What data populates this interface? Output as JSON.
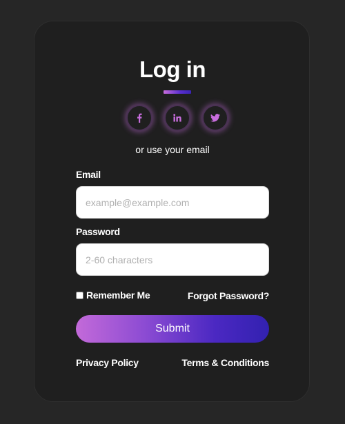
{
  "header": {
    "title": "Log in"
  },
  "social": {
    "buttons": [
      {
        "icon": "facebook-icon",
        "glyph": "f"
      },
      {
        "icon": "linkedin-icon",
        "glyph": "in"
      },
      {
        "icon": "twitter-icon",
        "glyph": "bird"
      }
    ],
    "accent_color": "#c86ddd",
    "alt_text": "or use your email"
  },
  "form": {
    "email": {
      "label": "Email",
      "value": "",
      "placeholder": "example@example.com"
    },
    "password": {
      "label": "Password",
      "value": "",
      "placeholder": "2-60 characters"
    },
    "remember_label": "Remember Me",
    "remember_checked": false,
    "forgot_label": "Forgot Password?",
    "submit_label": "Submit",
    "submit_gradient": [
      "#c36ad9",
      "#3221b0"
    ]
  },
  "footer": {
    "privacy_label": "Privacy Policy",
    "terms_label": "Terms & Conditions"
  }
}
